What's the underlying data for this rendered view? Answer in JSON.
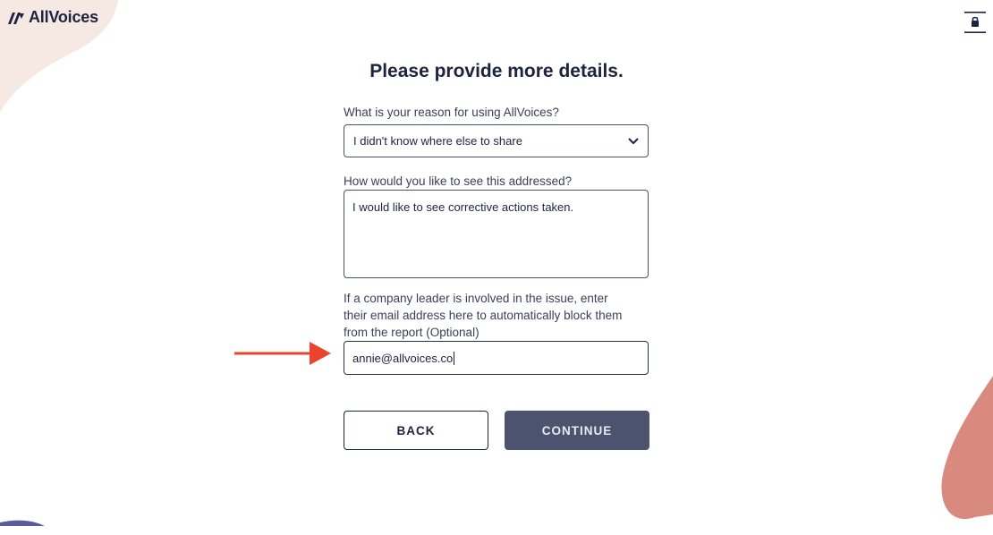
{
  "header": {
    "logo_text": "AllVoices",
    "lock_icon": "lock-icon"
  },
  "form": {
    "title": "Please provide more details.",
    "reason": {
      "label": "What is your reason for using AllVoices?",
      "value": "I didn't know where else to share"
    },
    "addressed": {
      "label": "How would you like to see this addressed?",
      "value": "I would like to see corrective actions taken."
    },
    "leader_email": {
      "label_line1": "If a company leader is involved in the issue, enter",
      "label_line2": "their email address here to automatically block them",
      "label_line3": "from the report (Optional)",
      "value": "annie@allvoices.co"
    },
    "back_label": "BACK",
    "continue_label": "CONTINUE"
  },
  "colors": {
    "navy": "#1d2340",
    "continue_bg": "#4b536e",
    "arrow": "#e8452c",
    "blob_peach": "#f5e6e0",
    "blob_coral": "#d98a7e",
    "blob_purple": "#5b5a9a"
  }
}
